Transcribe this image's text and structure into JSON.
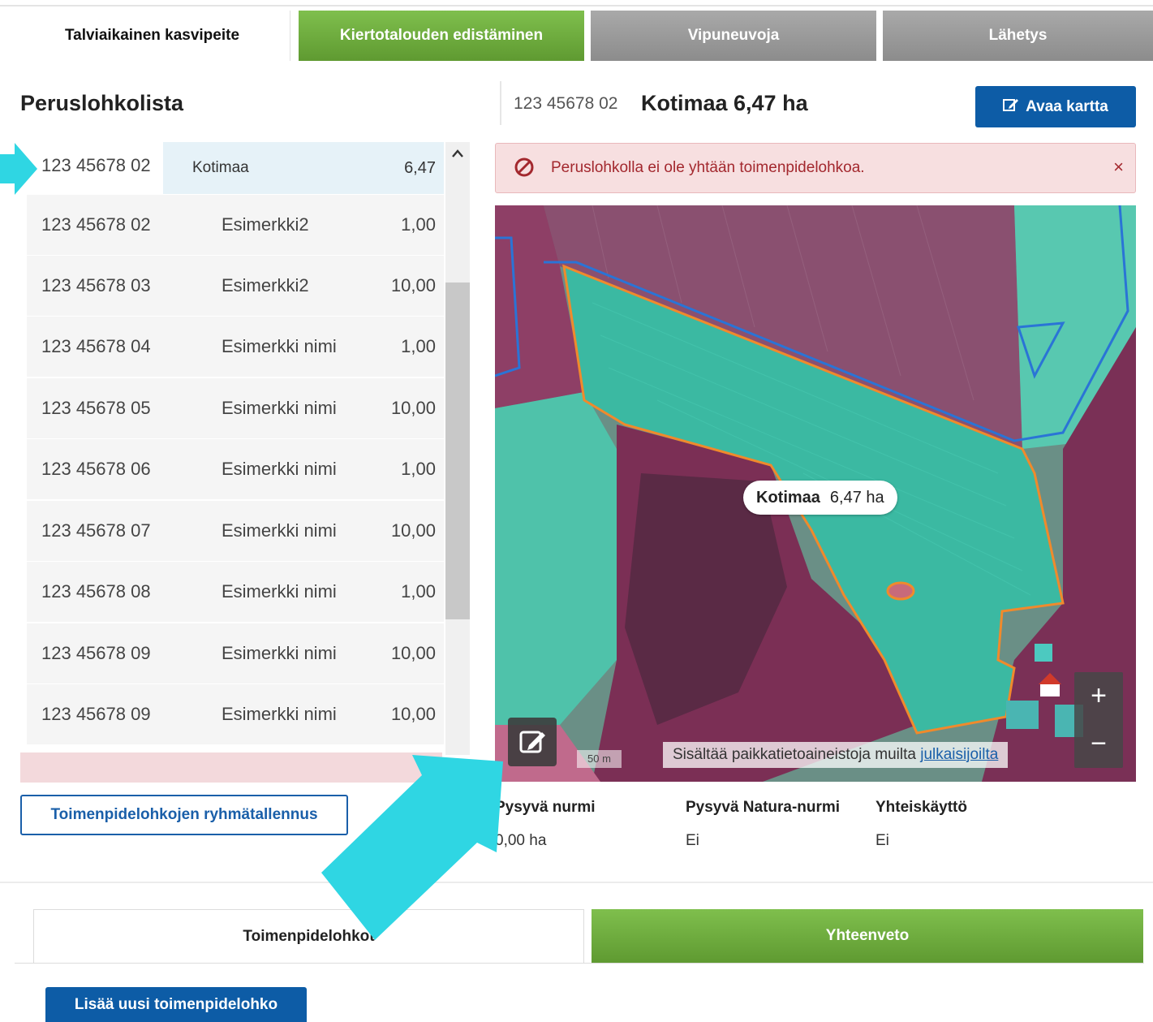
{
  "top_tabs": [
    {
      "label": "Talviaikainen kasvipeite"
    },
    {
      "label": "Kiertotalouden edistäminen"
    },
    {
      "label": "Vipuneuvoja"
    },
    {
      "label": "Lähetys"
    }
  ],
  "left": {
    "title": "Peruslohkolista",
    "rows": [
      {
        "id": "123 45678 02",
        "name": "Kotimaa",
        "area": "6,47"
      },
      {
        "id": "123 45678 02",
        "name": "Esimerkki2",
        "area": "1,00"
      },
      {
        "id": "123 45678 03",
        "name": "Esimerkki2",
        "area": "10,00"
      },
      {
        "id": "123 45678 04",
        "name": "Esimerkki nimi",
        "area": "1,00"
      },
      {
        "id": "123 45678 05",
        "name": "Esimerkki nimi",
        "area": "10,00"
      },
      {
        "id": "123 45678 06",
        "name": "Esimerkki nimi",
        "area": "1,00"
      },
      {
        "id": "123 45678 07",
        "name": "Esimerkki nimi",
        "area": "10,00"
      },
      {
        "id": "123 45678 08",
        "name": "Esimerkki nimi",
        "area": "1,00"
      },
      {
        "id": "123 45678 09",
        "name": "Esimerkki nimi",
        "area": "10,00"
      },
      {
        "id": "123 45678 09",
        "name": "Esimerkki nimi",
        "area": "10,00"
      }
    ],
    "group_save_label": "Toimenpidelohkojen ryhmätallennus"
  },
  "right": {
    "id": "123 45678 02",
    "title": "Kotimaa 6,47 ha",
    "open_map_label": "Avaa kartta",
    "alert_text": "Peruslohkolla ei ole yhtään toimenpidelohkoa.",
    "alert_close": "×",
    "map": {
      "label_name": "Kotimaa",
      "label_area": "6,47 ha",
      "scale": "50 m",
      "attribution_text": "Sisältää paikkatietoaineistoja muilta ",
      "attribution_link": "julkaisijoilta",
      "zoom_in": "+",
      "zoom_out": "−"
    },
    "info": [
      {
        "label": "Pysyvä nurmi",
        "value": "0,00 ha"
      },
      {
        "label": "Pysyvä Natura-nurmi",
        "value": "Ei"
      },
      {
        "label": "Yhteiskäyttö",
        "value": "Ei"
      }
    ]
  },
  "bottom_tabs": [
    {
      "label": "Toimenpidelohkot"
    },
    {
      "label": "Yhteenveto"
    }
  ],
  "add_button_label": "Lisää uusi toimenpidelohko",
  "colors": {
    "brand_blue": "#0d5ca6",
    "tab_green": "#6fae3e",
    "alert_red": "#a3282e",
    "annotation_cyan": "#2fd6e3"
  }
}
